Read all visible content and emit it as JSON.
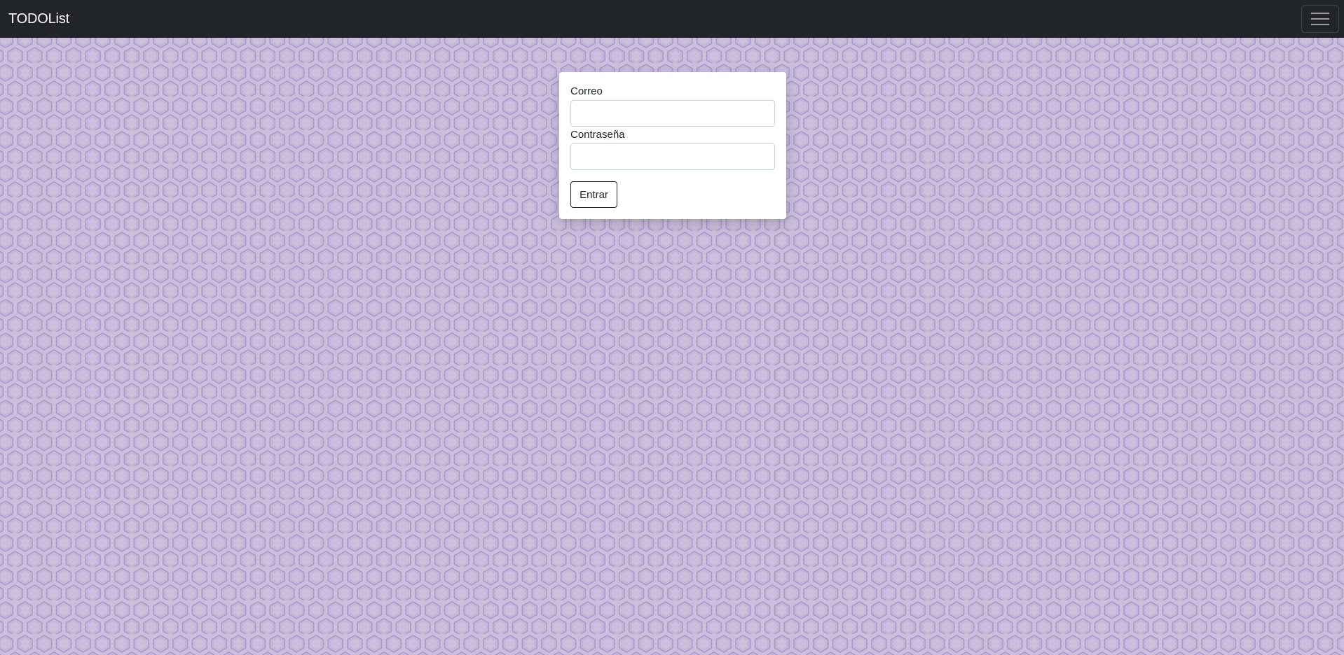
{
  "navbar": {
    "brand": "TODOList",
    "toggler_icon": "hamburger-menu-icon",
    "background_color": "#212529"
  },
  "background": {
    "pattern": "hexagon",
    "base_color": "#cbbfdc",
    "stroke_color": "#a996cc"
  },
  "login_form": {
    "email_label": "Correo",
    "email_value": "",
    "password_label": "Contraseña",
    "password_value": "",
    "submit_label": "Entrar"
  }
}
